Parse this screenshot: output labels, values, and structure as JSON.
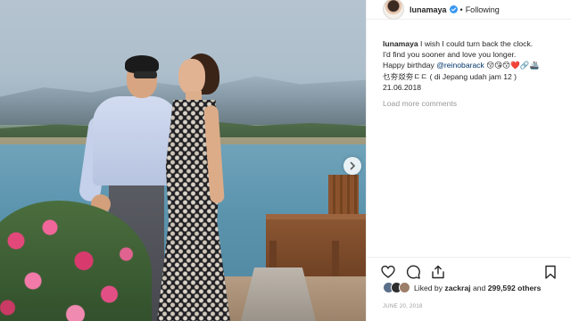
{
  "post": {
    "username": "lunamaya",
    "follow_status": "Following",
    "separator": "•",
    "caption": {
      "user": "lunamaya",
      "line1": " I wish I could turn back the clock.",
      "line2": "I'd find you sooner and love you longer.",
      "line3_prefix": "Happy birthday ",
      "mention": "@reinobarack",
      "line3_suffix": " 😚😘😙❤️🔗🚢",
      "line4": "乜夯㸚夯ㄷㄷ ( di Jepang udah jam 12 )",
      "line5": "21.06.2018"
    },
    "load_more_label": "Load more comments",
    "likes": {
      "prefix": "Liked by ",
      "user": "zackraj",
      "middle": " and ",
      "count": "299,592 others"
    },
    "date": "JUNE 20, 2018"
  },
  "colors": {
    "verified": "#3897f0",
    "mention": "#003569",
    "muted": "#999999"
  },
  "icons": [
    "verified-badge-icon",
    "heart-icon",
    "comment-icon",
    "share-icon",
    "bookmark-icon",
    "chevron-right-icon"
  ]
}
